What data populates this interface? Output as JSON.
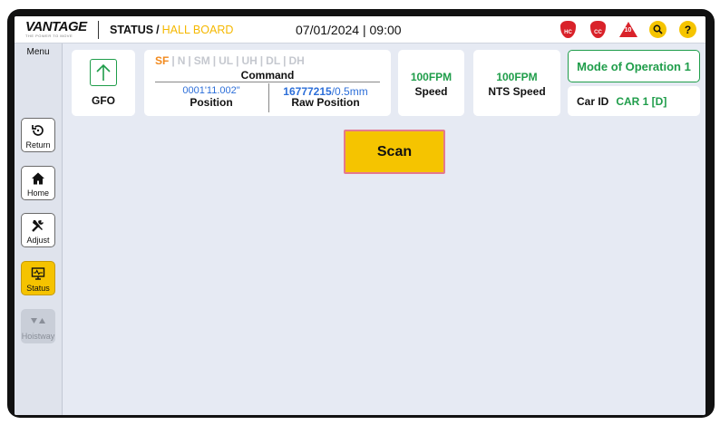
{
  "header": {
    "logo_text": "VANTAGE",
    "logo_tagline": "THE POWER TO MOVE",
    "breadcrumb_section": "STATUS",
    "breadcrumb_separator": "/",
    "breadcrumb_page": "HALL BOARD",
    "date": "07/01/2024",
    "time_separator": "|",
    "time": "09:00",
    "icons": [
      {
        "name": "hc-fault-shield-icon",
        "label": "HC",
        "color": "#d9222a"
      },
      {
        "name": "cc-fault-shield-icon",
        "label": "CC",
        "color": "#d9222a"
      },
      {
        "name": "alarm-warning-icon",
        "label": "10",
        "color": "#d9222a"
      },
      {
        "name": "search-icon",
        "color": "#f5c400"
      },
      {
        "name": "help-icon",
        "label": "?",
        "color": "#f5c400"
      }
    ]
  },
  "sidebar": {
    "menu_label": "Menu",
    "items": [
      {
        "label": "Return",
        "icon": "return-icon",
        "state": "normal"
      },
      {
        "label": "Home",
        "icon": "home-icon",
        "state": "normal"
      },
      {
        "label": "Adjust",
        "icon": "tools-icon",
        "state": "normal"
      },
      {
        "label": "Status",
        "icon": "monitor-icon",
        "state": "active"
      },
      {
        "label": "Hoistway",
        "icon": "hoistway-arrows-icon",
        "state": "disabled"
      }
    ]
  },
  "status": {
    "direction_icon": "arrow-up-icon",
    "door_label": "GFO",
    "command_modes": [
      {
        "label": "SF",
        "active": true
      },
      {
        "label": "N",
        "active": false
      },
      {
        "label": "SM",
        "active": false
      },
      {
        "label": "UL",
        "active": false
      },
      {
        "label": "UH",
        "active": false
      },
      {
        "label": "DL",
        "active": false
      },
      {
        "label": "DH",
        "active": false
      }
    ],
    "command_separator": "|",
    "command_label": "Command",
    "position_value": "0001'11.002\"",
    "position_label": "Position",
    "raw_position_value": "16777215",
    "raw_position_unit": "/0.5mm",
    "raw_position_label": "Raw Position",
    "speed_value": "100FPM",
    "speed_label": "Speed",
    "nts_speed_value": "100FPM",
    "nts_speed_label": "NTS Speed",
    "mode_of_operation": "Mode of Operation 1",
    "car_id_label": "Car ID",
    "car_id_value": "CAR 1 [D]"
  },
  "actions": {
    "scan_label": "Scan"
  },
  "colors": {
    "accent_yellow": "#f5c400",
    "green": "#1f9d4a",
    "blue_value": "#2d6fd9",
    "orange_active": "#f28a1e",
    "alert_red": "#d9222a"
  }
}
